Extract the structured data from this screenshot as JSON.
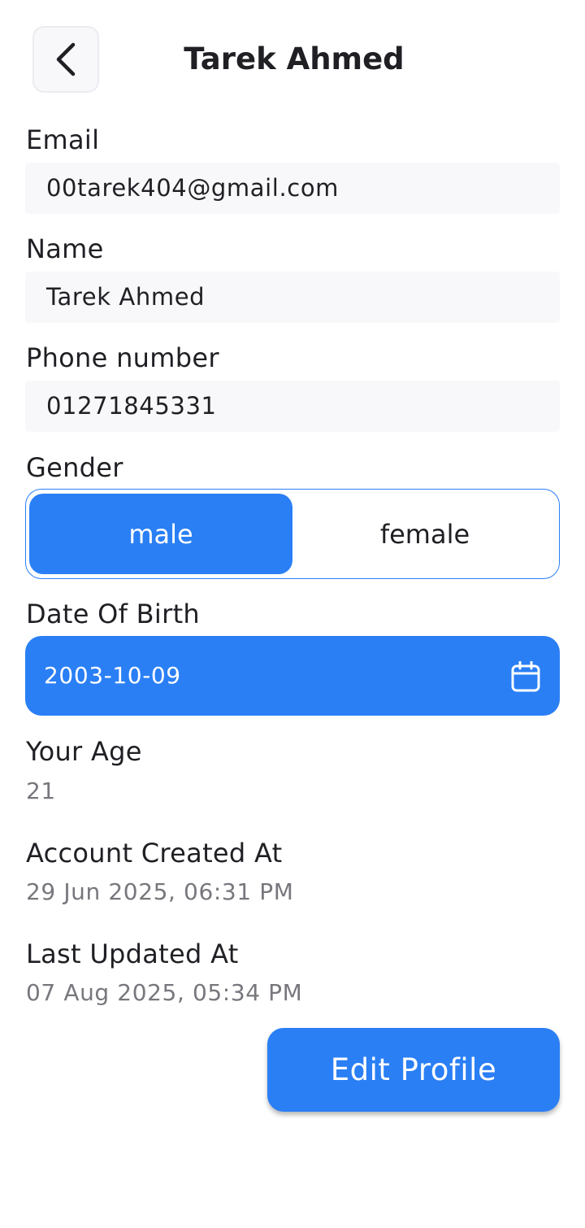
{
  "header": {
    "title": "Tarek Ahmed",
    "back_icon": "chevron-left-icon"
  },
  "form": {
    "email": {
      "label": "Email",
      "value": "00tarek404@gmail.com"
    },
    "name": {
      "label": "Name",
      "value": "Tarek Ahmed"
    },
    "phone": {
      "label": "Phone number",
      "value": "01271845331"
    },
    "gender": {
      "label": "Gender",
      "options": [
        "male",
        "female"
      ],
      "selected": "male"
    },
    "dob": {
      "label": "Date Of Birth",
      "value": "2003-10-09",
      "icon": "calendar-icon"
    }
  },
  "info": {
    "age": {
      "label": "Your Age",
      "value": "21"
    },
    "created": {
      "label": "Account Created At",
      "value": "29 Jun 2025, 06:31 PM"
    },
    "updated": {
      "label": "Last Updated At",
      "value": "07 Aug 2025, 05:34 PM"
    }
  },
  "actions": {
    "edit_label": "Edit Profile"
  },
  "colors": {
    "accent": "#2a7ff5",
    "text": "#1f1f24",
    "muted": "#77777d",
    "field_bg": "#f8f8fb"
  }
}
